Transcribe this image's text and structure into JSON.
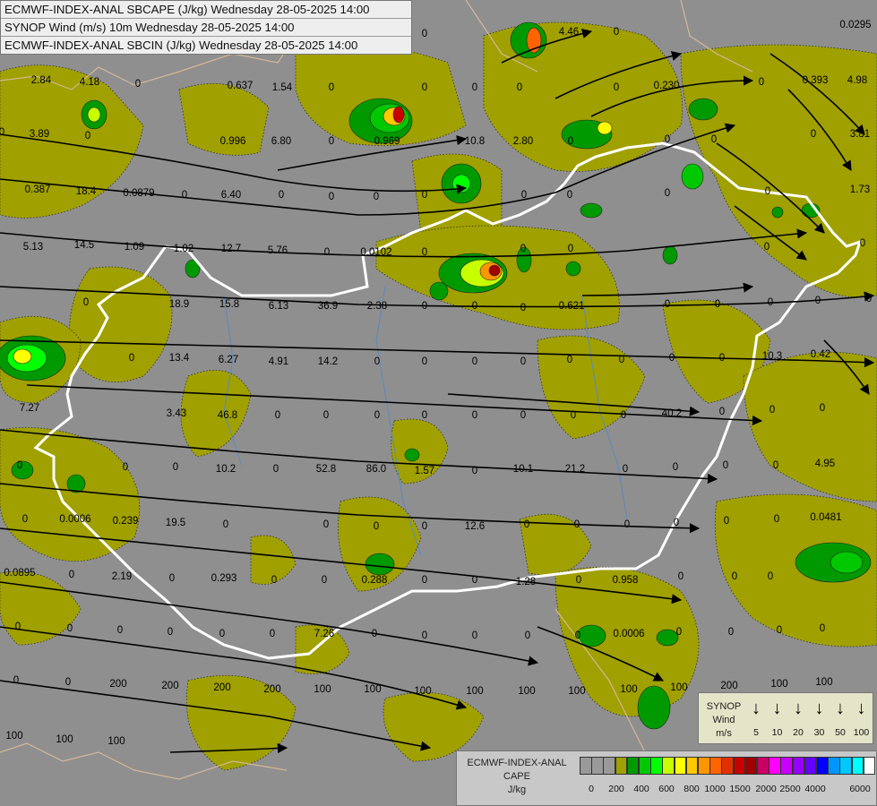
{
  "header": {
    "line1": "ECMWF-INDEX-ANAL SBCAPE (J/kg) Wednesday 28-05-2025 14:00",
    "line2": "SYNOP Wind (m/s) 10m Wednesday 28-05-2025 14:00",
    "line3": "ECMWF-INDEX-ANAL SBCIN (J/kg) Wednesday 28-05-2025 14:00"
  },
  "map_values": [
    "0",
    "0.0295",
    "4.46",
    "0",
    "2.84",
    "4.18",
    "0",
    "0.637",
    "1.54",
    "0",
    "0",
    "0",
    "0",
    "0",
    "0.230",
    "0",
    "0.393",
    "4.98",
    "0",
    "3.89",
    "0",
    "0.996",
    "6.80",
    "0",
    "0.969",
    "10.8",
    "2.80",
    "0",
    "0",
    "0",
    "0",
    "3.81",
    "0.387",
    "18.4",
    "0.0879",
    "0",
    "6.40",
    "0",
    "0",
    "0",
    "0",
    "0",
    "0",
    "0",
    "0",
    "1.73",
    "14.5",
    "1.09",
    "1.02",
    "12.7",
    "5.76",
    "0",
    "0.0102",
    "0",
    "0",
    "0",
    "0",
    "0",
    "5.13",
    "0",
    "18.9",
    "15.8",
    "6.13",
    "36.9",
    "2.38",
    "0",
    "0",
    "0",
    "0.621",
    "0",
    "0",
    "0",
    "0",
    "0",
    "0",
    "13.4",
    "6.27",
    "4.91",
    "14.2",
    "0",
    "0",
    "0",
    "0",
    "0",
    "0",
    "0",
    "0",
    "10.3",
    "0.42",
    "7.27",
    "3.43",
    "46.8",
    "0",
    "0",
    "0",
    "0",
    "0",
    "0",
    "0",
    "0",
    "40.2",
    "0",
    "0",
    "0",
    "0",
    "0",
    "0",
    "10.2",
    "0",
    "52.8",
    "86.0",
    "1.57",
    "0",
    "10.1",
    "21.2",
    "0",
    "0",
    "0",
    "0",
    "4.95",
    "0",
    "0.0006",
    "0.239",
    "19.5",
    "0",
    "0",
    "0",
    "0",
    "12.6",
    "0",
    "0",
    "0",
    "0",
    "0",
    "0",
    "0.0481",
    "0.0895",
    "0",
    "2.19",
    "0",
    "0.293",
    "0",
    "0",
    "0.288",
    "0",
    "0",
    "1.28",
    "0",
    "0.958",
    "0",
    "0",
    "0",
    "0",
    "0",
    "0",
    "0",
    "0",
    "0",
    "7.26",
    "0",
    "0",
    "0",
    "0",
    "0",
    "0.0006",
    "0",
    "0",
    "0",
    "0",
    "0",
    "0",
    "200",
    "200",
    "200",
    "200",
    "100",
    "100",
    "100",
    "100",
    "100",
    "100",
    "100",
    "100",
    "200",
    "100",
    "100",
    "100",
    "100",
    "100"
  ],
  "synop_legend": {
    "title_line1": "SYNOP",
    "title_line2": "Wind",
    "unit": "m/s",
    "bins": [
      "5",
      "10",
      "20",
      "30",
      "50",
      "100"
    ],
    "arrow_glyph": "↓"
  },
  "cape_legend": {
    "title_line1": "ECMWF-INDEX-ANAL",
    "title_line2": "CAPE",
    "unit": "J/kg",
    "colors": [
      "#9a9a9a",
      "#9a9a9a",
      "#9a9a9a",
      "#a0a000",
      "#009a00",
      "#00c800",
      "#00ff00",
      "#c8ff00",
      "#ffff00",
      "#ffc800",
      "#ff9600",
      "#ff6400",
      "#e03200",
      "#c80000",
      "#a00000",
      "#c80064",
      "#ff00ff",
      "#c800ff",
      "#9600ff",
      "#6400ff",
      "#0000ff",
      "#0096ff",
      "#00c8ff",
      "#00ffff",
      "#ffffff"
    ],
    "ticks": [
      "0",
      "200",
      "400",
      "600",
      "800",
      "1000",
      "1500",
      "2000",
      "2500",
      "4000",
      "6000"
    ]
  }
}
